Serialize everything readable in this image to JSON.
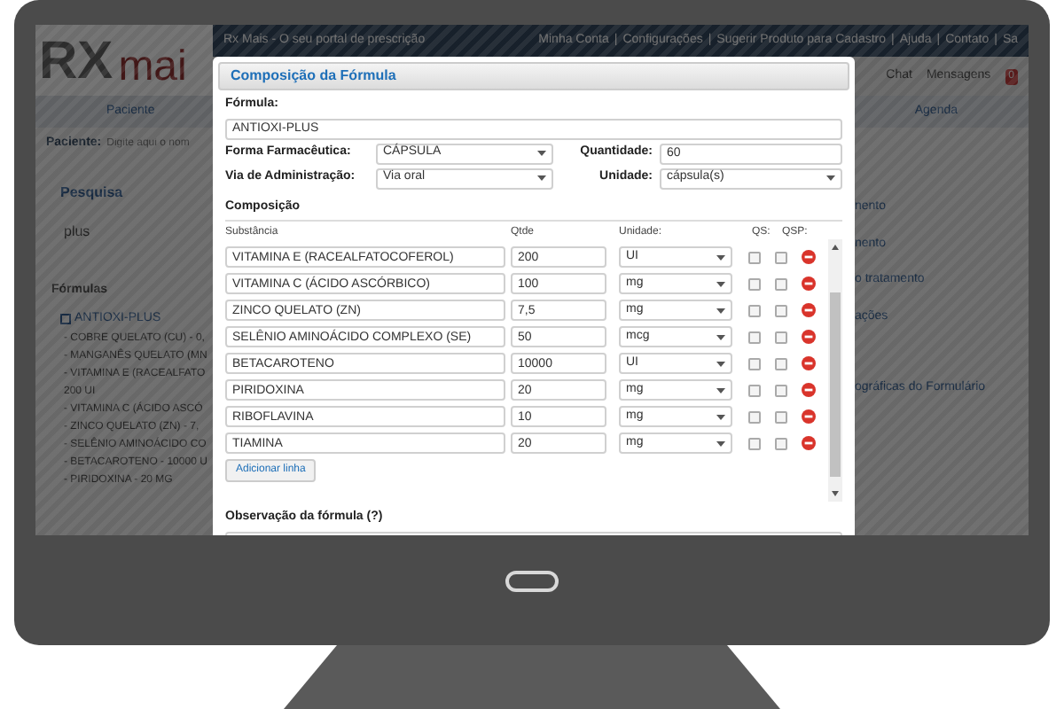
{
  "header": {
    "logo": {
      "primary": "RX",
      "secondary": "mai"
    },
    "tagline": "Rx Mais - O seu portal de prescrição",
    "separator": "|",
    "links": [
      "Minha Conta",
      "Configurações",
      "Sugerir Produto para Cadastro",
      "Ajuda",
      "Contato",
      "Sa"
    ],
    "chat": "Chat",
    "messages": "Mensagens",
    "message_count": "0"
  },
  "nav": [
    "Paciente",
    "Agenda"
  ],
  "patient": {
    "label": "Paciente:",
    "placeholder": "Digite aqui o nom"
  },
  "search": {
    "title": "Pesquisa",
    "value": "plus"
  },
  "formulas": {
    "title": "Fórmulas",
    "name": "ANTIOXI-PLUS",
    "items": [
      "- COBRE QUELATO (CU) - 0,",
      "- MANGANÊS QUELATO (MN",
      "- VITAMINA E (RACEALFATO",
      "200 UI",
      "- VITAMINA C (ÁCIDO ASCÓ",
      "- ZINCO QUELATO (ZN) - 7,",
      "- SELÊNIO AMINOÁCIDO CO",
      "- BETACAROTENO - 10000 U",
      "- PIRIDOXINA - 20 MG"
    ]
  },
  "right_links": [
    "nento",
    "nento",
    "o tratamento",
    "ações",
    "ográficas do Formulário"
  ],
  "dialog": {
    "title": "Composição da Fórmula",
    "formula": {
      "label": "Fórmula:",
      "value": "ANTIOXI-PLUS"
    },
    "form": {
      "label": "Forma Farmacêutica:",
      "value": "CÁPSULA"
    },
    "quantity": {
      "label": "Quantidade:",
      "value": "60"
    },
    "route": {
      "label": "Via de Administração:",
      "value": "Via oral"
    },
    "unit": {
      "label": "Unidade:",
      "value": "cápsula(s)"
    },
    "composition_title": "Composição",
    "columns": [
      "Substância",
      "Qtde",
      "Unidade:",
      "QS:",
      "QSP:"
    ],
    "rows": [
      {
        "substance": "VITAMINA E (RACEALFATOCOFEROL)",
        "qty": "200",
        "unit": "UI",
        "qs": false,
        "qsp": false
      },
      {
        "substance": "VITAMINA C (ÁCIDO ASCÓRBICO)",
        "qty": "100",
        "unit": "mg",
        "qs": false,
        "qsp": false
      },
      {
        "substance": "ZINCO QUELATO (ZN)",
        "qty": "7,5",
        "unit": "mg",
        "qs": false,
        "qsp": false
      },
      {
        "substance": "SELÊNIO AMINOÁCIDO COMPLEXO (SE)",
        "qty": "50",
        "unit": "mcg",
        "qs": false,
        "qsp": false
      },
      {
        "substance": "BETACAROTENO",
        "qty": "10000",
        "unit": "UI",
        "qs": false,
        "qsp": false
      },
      {
        "substance": "PIRIDOXINA",
        "qty": "20",
        "unit": "mg",
        "qs": false,
        "qsp": false
      },
      {
        "substance": "RIBOFLAVINA",
        "qty": "10",
        "unit": "mg",
        "qs": false,
        "qsp": false
      },
      {
        "substance": "TIAMINA",
        "qty": "20",
        "unit": "mg",
        "qs": false,
        "qsp": false
      }
    ],
    "add_button": "Adicionar linha",
    "observation": {
      "label": "Observação da fórmula (?)"
    }
  }
}
